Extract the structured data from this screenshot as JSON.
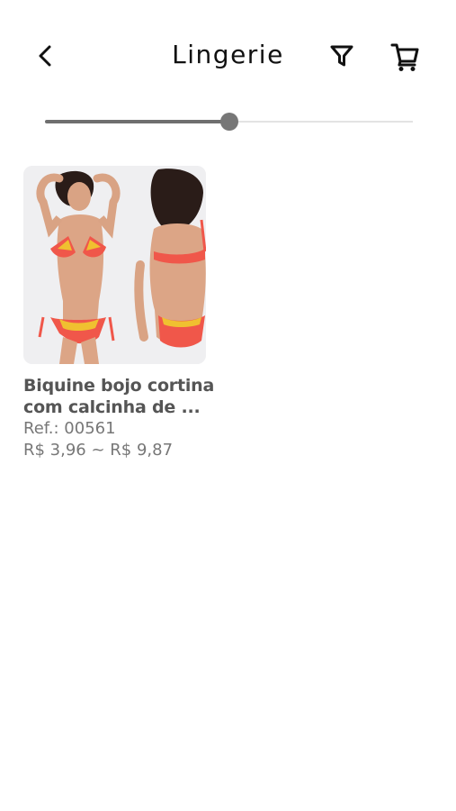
{
  "header": {
    "title": "Lingerie",
    "back_icon": "chevron-left-icon",
    "filter_icon": "filter-icon",
    "cart_icon": "cart-icon"
  },
  "slider": {
    "value_fraction": 0.5
  },
  "products": [
    {
      "name_line1": "Biquine bojo cortina",
      "name_line2": "com calcinha de ...",
      "ref": "Ref.: 00561",
      "price": "R$ 3,96 ~ R$ 9,87",
      "image_icon": "bikini-photo",
      "accent_color": "#f0574a"
    }
  ]
}
